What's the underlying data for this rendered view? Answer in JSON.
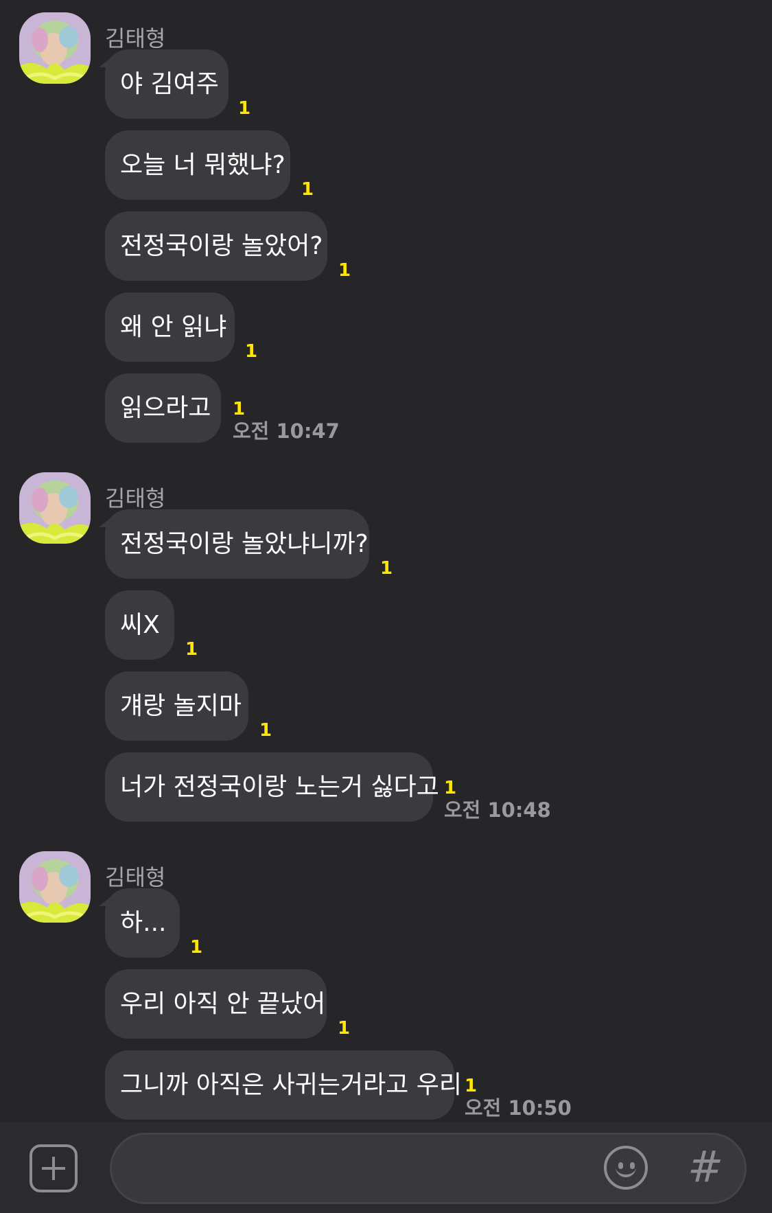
{
  "chat": {
    "groups": [
      {
        "sender": "김태형",
        "messages": [
          {
            "text": "야 김여주",
            "unread": "1",
            "time": ""
          },
          {
            "text": "오늘 너 뭐했냐?",
            "unread": "1",
            "time": ""
          },
          {
            "text": "전정국이랑 놀았어?",
            "unread": "1",
            "time": ""
          },
          {
            "text": "왜 안 읽냐",
            "unread": "1",
            "time": ""
          },
          {
            "text": "읽으라고",
            "unread": "1",
            "time": "오전 10:47"
          }
        ]
      },
      {
        "sender": "김태형",
        "messages": [
          {
            "text": "전정국이랑 놀았냐니까?",
            "unread": "1",
            "time": ""
          },
          {
            "text": "씨X",
            "unread": "1",
            "time": ""
          },
          {
            "text": "걔랑 놀지마",
            "unread": "1",
            "time": ""
          },
          {
            "text": "너가 전정국이랑 노는거 싫다고",
            "unread": "1",
            "time": "오전 10:48"
          }
        ]
      },
      {
        "sender": "김태형",
        "messages": [
          {
            "text": "하...",
            "unread": "1",
            "time": ""
          },
          {
            "text": "우리 아직 안 끝났어",
            "unread": "1",
            "time": ""
          },
          {
            "text": "그니까 아직은 사귀는거라고 우리",
            "unread": "1",
            "time": "오전 10:50"
          }
        ]
      }
    ]
  },
  "input_bar": {
    "add_icon": "plus-square-icon",
    "message_value": "",
    "emoji_icon": "smiley-icon",
    "hash_icon": "hashtag-icon",
    "hash_glyph": "#"
  },
  "colors": {
    "background": "#262628",
    "bubble": "#3b3b3f",
    "unread": "#ffe600",
    "meta_text": "#9a9a9e"
  }
}
